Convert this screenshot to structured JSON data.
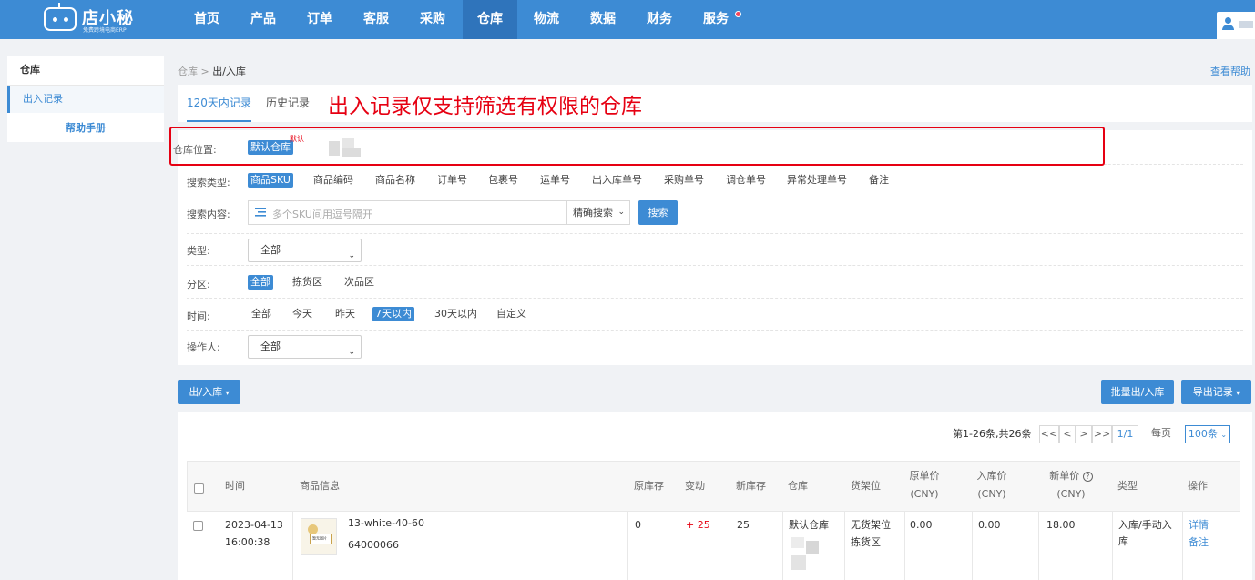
{
  "brand": {
    "name": "店小秘",
    "tagline": "免费跨境电商ERP"
  },
  "nav": [
    {
      "label": "首页",
      "active": false
    },
    {
      "label": "产品",
      "active": false
    },
    {
      "label": "订单",
      "active": false
    },
    {
      "label": "客服",
      "active": false
    },
    {
      "label": "采购",
      "active": false
    },
    {
      "label": "仓库",
      "active": true
    },
    {
      "label": "物流",
      "active": false
    },
    {
      "label": "数据",
      "active": false
    },
    {
      "label": "财务",
      "active": false
    },
    {
      "label": "服务",
      "active": false
    }
  ],
  "sidebar": {
    "title": "仓库",
    "item": "出入记录",
    "help": "帮助手册"
  },
  "breadcrumb": {
    "root": "仓库",
    "sep": ">",
    "current": "出/入库"
  },
  "help_link": "查看帮助",
  "tabs": [
    "120天内记录",
    "历史记录"
  ],
  "annotation": "出入记录仅支持筛选有权限的仓库",
  "filters": {
    "warehouse": {
      "label": "仓库位置:",
      "selected": "默认仓库",
      "tiny_note": "默认"
    },
    "search_type": {
      "label": "搜索类型:",
      "options": [
        "商品SKU",
        "商品编码",
        "商品名称",
        "订单号",
        "包裹号",
        "运单号",
        "出入库单号",
        "采购单号",
        "调仓单号",
        "异常处理单号",
        "备注"
      ]
    },
    "search_content": {
      "label": "搜索内容:",
      "placeholder": "多个SKU间用逗号隔开",
      "mode": "精确搜索",
      "button": "搜索"
    },
    "type": {
      "label": "类型:",
      "value": "全部"
    },
    "zone": {
      "label": "分区:",
      "options": [
        "全部",
        "拣货区",
        "次品区"
      ]
    },
    "time": {
      "label": "时间:",
      "options": [
        "全部",
        "今天",
        "昨天",
        "7天以内",
        "30天以内",
        "自定义"
      ]
    },
    "operator": {
      "label": "操作人:",
      "value": "全部"
    }
  },
  "toolbar": {
    "inout": "出/入库",
    "batch": "批量出/入库",
    "export": "导出记录"
  },
  "pager": {
    "summary": "第1-26条,共26条",
    "first": "<<",
    "prev": "<",
    "next": ">",
    "last": ">>",
    "page": "1/1",
    "per_label": "每页",
    "per_value": "100条"
  },
  "columns": {
    "time": "时间",
    "product": "商品信息",
    "old_stock": "原库存",
    "change": "变动",
    "new_stock": "新库存",
    "warehouse": "仓库",
    "shelf": "货架位",
    "old_price": "原单价",
    "in_price": "入库价",
    "new_price": "新单价",
    "cny": "(CNY)",
    "type": "类型",
    "action": "操作"
  },
  "rows": [
    {
      "date": "2023-04-13",
      "clock": "16:00:38",
      "thumb_text": "暂无图片",
      "sku": "13-white-40-60",
      "code": "64000066",
      "old_stock": "0",
      "change": "+ 25",
      "new_stock": "25",
      "warehouse": "默认仓库",
      "shelf": "无货架位",
      "zone": "拣货区",
      "old_price": "0.00",
      "in_price": "0.00",
      "new_price": "18.00",
      "type": "入库/手动入库",
      "detail": "详情",
      "remark": "备注"
    }
  ],
  "colors": {
    "primary": "#3d8bd4",
    "nav_active": "#2f74bb",
    "annotation": "#e60012",
    "change": "#e60012"
  },
  "icons": [
    "robot-logo-icon",
    "user-icon",
    "chevron-down-icon",
    "list-icon",
    "help-circle-icon",
    "checkbox-icon"
  ]
}
